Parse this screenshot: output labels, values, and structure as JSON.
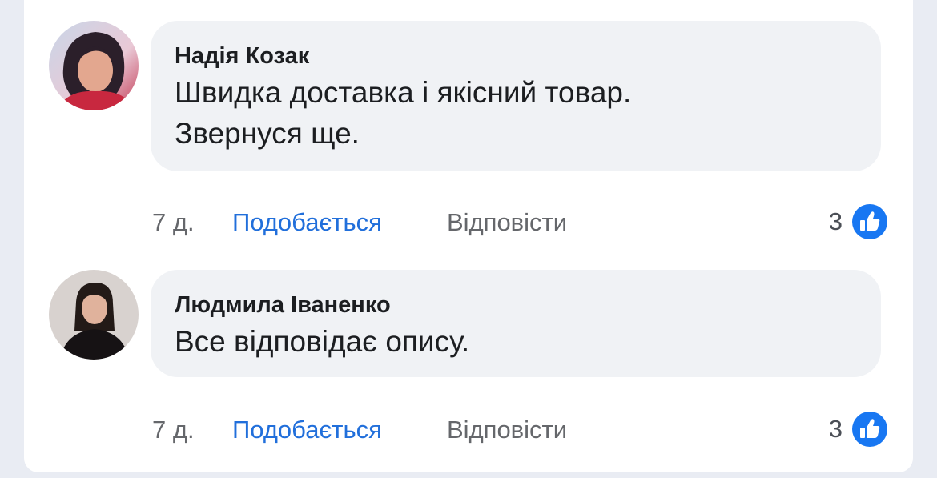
{
  "comments": [
    {
      "author": "Надія Козак",
      "text_lines": [
        "Швидка доставка і якісний товар.",
        "Звернуся ще."
      ],
      "time": "7 д.",
      "like_label": "Подобається",
      "reply_label": "Відповісти",
      "reaction_count": "3",
      "reaction_icon": "thumbs-up-icon"
    },
    {
      "author": "Людмила Іваненко",
      "text_lines": [
        "Все відповідає опису."
      ],
      "time": "7 д.",
      "like_label": "Подобається",
      "reply_label": "Відповісти",
      "reaction_count": "3",
      "reaction_icon": "thumbs-up-icon"
    }
  ],
  "colors": {
    "accent": "#216fdb",
    "bubble": "#f0f2f5",
    "muted_text": "#65676b",
    "text": "#1c1e21"
  }
}
